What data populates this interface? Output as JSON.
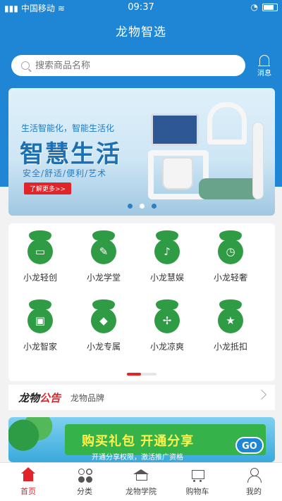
{
  "status_bar": {
    "carrier": "中国移动",
    "time": "09:37"
  },
  "header": {
    "title": "龙物智选"
  },
  "search": {
    "placeholder": "搜索商品名称"
  },
  "bell": {
    "label": "消息",
    "icon": "bell-icon"
  },
  "banner": {
    "tagline": "生活智能化，智能生活化",
    "headline": "智慧生活",
    "subline": "安全/舒适/便利/艺术",
    "more_button": "了解更多>>",
    "dot_count": 3,
    "active_dot": 2
  },
  "grid": {
    "items": [
      {
        "label": "小龙轻创",
        "icon": "tv-icon",
        "glyph": "▭"
      },
      {
        "label": "小龙学堂",
        "icon": "pen-icon",
        "glyph": "✎"
      },
      {
        "label": "小龙慧娱",
        "icon": "microphone-icon",
        "glyph": "♪"
      },
      {
        "label": "小龙轻奢",
        "icon": "watch-icon",
        "glyph": "◷"
      },
      {
        "label": "小龙智家",
        "icon": "screen-icon",
        "glyph": "▣"
      },
      {
        "label": "小龙专属",
        "icon": "treasure-icon",
        "glyph": "◆"
      },
      {
        "label": "小龙凉爽",
        "icon": "fan-icon",
        "glyph": "✢"
      },
      {
        "label": "小龙抵扣",
        "icon": "star-icon",
        "glyph": "★"
      }
    ]
  },
  "notice": {
    "brand_part1": "龙物",
    "brand_part2": "公告",
    "text": "龙物品牌"
  },
  "promo": {
    "title": "购买礼包  开通分享",
    "subtitle": "开通分享权限，激活推广资格",
    "go": "GO"
  },
  "tabbar": {
    "tabs": [
      {
        "label": "首页",
        "icon": "home-icon",
        "active": true
      },
      {
        "label": "分类",
        "icon": "category-icon",
        "active": false
      },
      {
        "label": "龙物学院",
        "icon": "graduation-cap-icon",
        "active": false
      },
      {
        "label": "购物车",
        "icon": "cart-icon",
        "active": false
      },
      {
        "label": "我的",
        "icon": "user-icon",
        "active": false
      }
    ]
  },
  "colors": {
    "brand_blue": "#1e86d5",
    "accent_red": "#e0242a",
    "icon_green": "#2f9c45"
  }
}
